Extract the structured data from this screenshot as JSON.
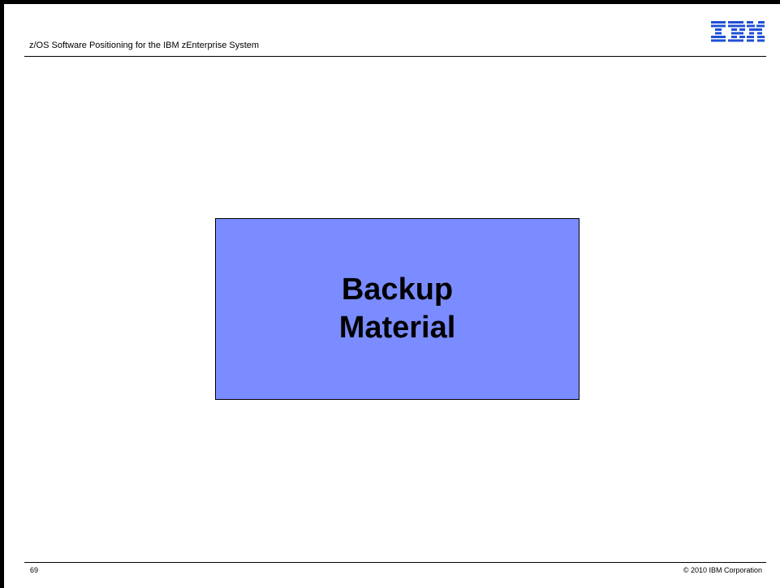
{
  "header": {
    "title": "z/OS Software Positioning for the IBM zEnterprise System",
    "logo_text": "IBM",
    "logo_color": "#1f4fd6"
  },
  "main": {
    "box_color": "#7a8cff",
    "box_lines": [
      "Backup",
      "Material"
    ]
  },
  "footer": {
    "page_number": "69",
    "copyright": "© 2010 IBM Corporation"
  }
}
